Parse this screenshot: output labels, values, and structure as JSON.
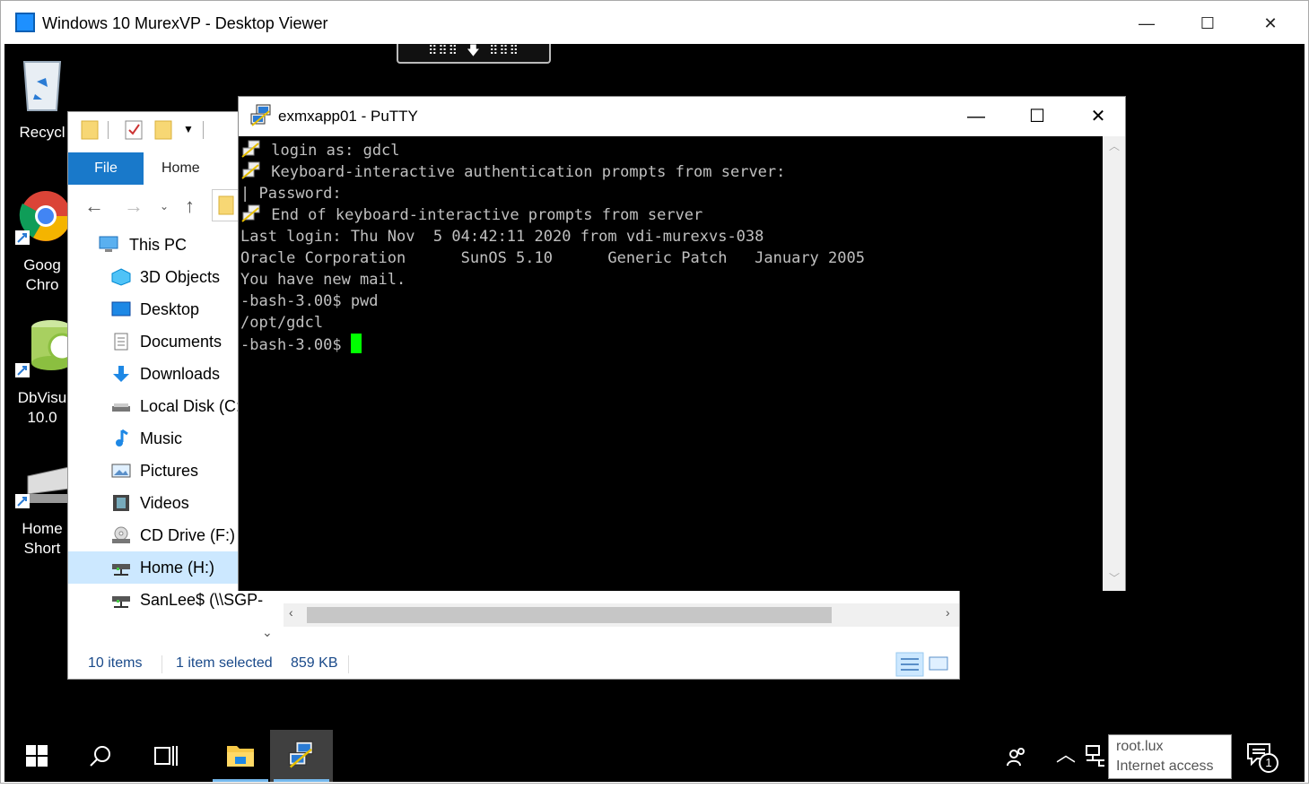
{
  "viewer": {
    "title": "Windows 10 MurexVP - Desktop Viewer",
    "minimize": "—",
    "maximize": "☐",
    "close": "✕"
  },
  "rdp_bar": {
    "label": "⠿⠿⠿ 🡇 ⠿⠿⠿"
  },
  "desktop_icons": [
    {
      "name": "recycle-bin",
      "line1": "Recycl",
      "line2": ""
    },
    {
      "name": "google-chrome",
      "line1": "Goog",
      "line2": "Chro"
    },
    {
      "name": "dbvisualizer",
      "line1": "DbVisu",
      "line2": "10.0"
    },
    {
      "name": "home-shortcut",
      "line1": "Home",
      "line2": "Short"
    }
  ],
  "explorer": {
    "tab_file": "File",
    "tab_home": "Home",
    "tree": [
      {
        "label": "This PC",
        "icon": "pc-icon"
      },
      {
        "label": "3D Objects",
        "icon": "3d-objects-icon"
      },
      {
        "label": "Desktop",
        "icon": "desktop-icon"
      },
      {
        "label": "Documents",
        "icon": "documents-icon"
      },
      {
        "label": "Downloads",
        "icon": "downloads-icon"
      },
      {
        "label": "Local Disk (C:",
        "icon": "disk-icon"
      },
      {
        "label": "Music",
        "icon": "music-icon"
      },
      {
        "label": "Pictures",
        "icon": "pictures-icon"
      },
      {
        "label": "Videos",
        "icon": "videos-icon"
      },
      {
        "label": "CD Drive (F:)",
        "icon": "cd-drive-icon"
      },
      {
        "label": "Home (H:)",
        "icon": "network-drive-icon"
      },
      {
        "label": "SanLee$ (\\\\SGP-",
        "icon": "network-drive-icon"
      }
    ],
    "status": {
      "items": "10 items",
      "selected": "1 item selected",
      "size": "859 KB"
    }
  },
  "putty": {
    "title": "exmxapp01 - PuTTY",
    "minimize": "—",
    "maximize": "☐",
    "close": "✕",
    "lines": [
      {
        "icon": true,
        "text": " login as: gdcl"
      },
      {
        "icon": true,
        "text": " Keyboard-interactive authentication prompts from server:"
      },
      {
        "icon": false,
        "text": "| Password:"
      },
      {
        "icon": true,
        "text": " End of keyboard-interactive prompts from server"
      },
      {
        "icon": false,
        "text": "Last login: Thu Nov  5 04:42:11 2020 from vdi-murexvs-038"
      },
      {
        "icon": false,
        "text": "Oracle Corporation      SunOS 5.10      Generic Patch   January 2005"
      },
      {
        "icon": false,
        "text": "You have new mail."
      },
      {
        "icon": false,
        "text": "-bash-3.00$ pwd"
      },
      {
        "icon": false,
        "text": "/opt/gdcl"
      },
      {
        "icon": false,
        "text": "-bash-3.00$ "
      }
    ]
  },
  "taskbar": {
    "tray_tooltip_line1": "root.lux",
    "tray_tooltip_line2": "Internet access",
    "notification_count": "1"
  },
  "colors": {
    "accent": "#1979ca",
    "terminal_bg": "#000000",
    "terminal_fg": "#c0c0c0",
    "cursor": "#00ff00"
  }
}
